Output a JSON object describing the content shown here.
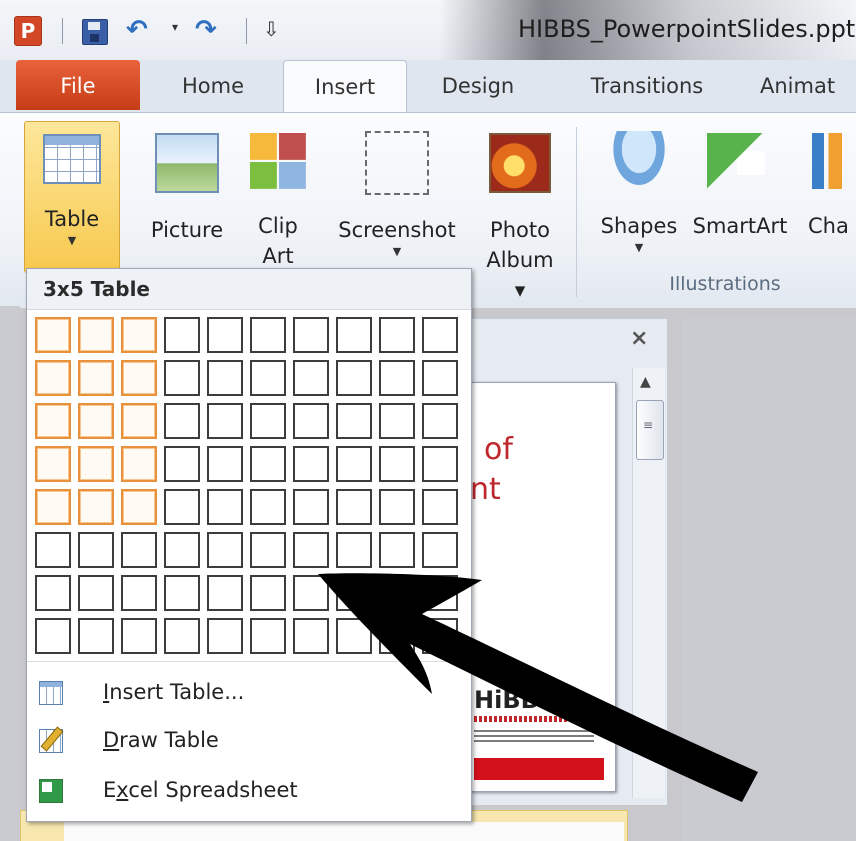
{
  "window": {
    "app_icon_letter": "P",
    "title": "HIBBS_PowerpointSlides.ppt"
  },
  "tabs": {
    "file": "File",
    "home": "Home",
    "insert": "Insert",
    "design": "Design",
    "transitions": "Transitions",
    "animations": "Animat"
  },
  "ribbon": {
    "table_label": "Table",
    "picture_label": "Picture",
    "clipart_label_1": "Clip",
    "clipart_label_2": "Art",
    "screenshot_label": "Screenshot",
    "photoalbum_label_1": "Photo",
    "photoalbum_label_2": "Album",
    "shapes_label": "Shapes",
    "smartart_label": "SmartArt",
    "chart_label": "Cha",
    "group_illustrations": "Illustrations"
  },
  "table_dropdown": {
    "header": "3x5 Table",
    "grid_columns": 10,
    "grid_rows": 8,
    "selected_columns": 3,
    "selected_rows": 5,
    "menu": [
      {
        "pre": "",
        "accel": "I",
        "post": "nsert Table..."
      },
      {
        "pre": "",
        "accel": "D",
        "post": "raw Table"
      },
      {
        "pre": "E",
        "accel": "x",
        "post": "cel Spreadsheet"
      }
    ]
  },
  "slide": {
    "title_line_1": "of",
    "title_line_2": "nt",
    "logo_text": "HiBBs"
  },
  "colors": {
    "file_tab": "#d9532a",
    "accent_selection": "#e8903b",
    "arrow": "#000000",
    "slide_red": "#c0272d"
  },
  "icons": {
    "app": "powerpoint-icon",
    "save": "save-icon",
    "undo": "undo-icon",
    "redo": "redo-icon"
  }
}
